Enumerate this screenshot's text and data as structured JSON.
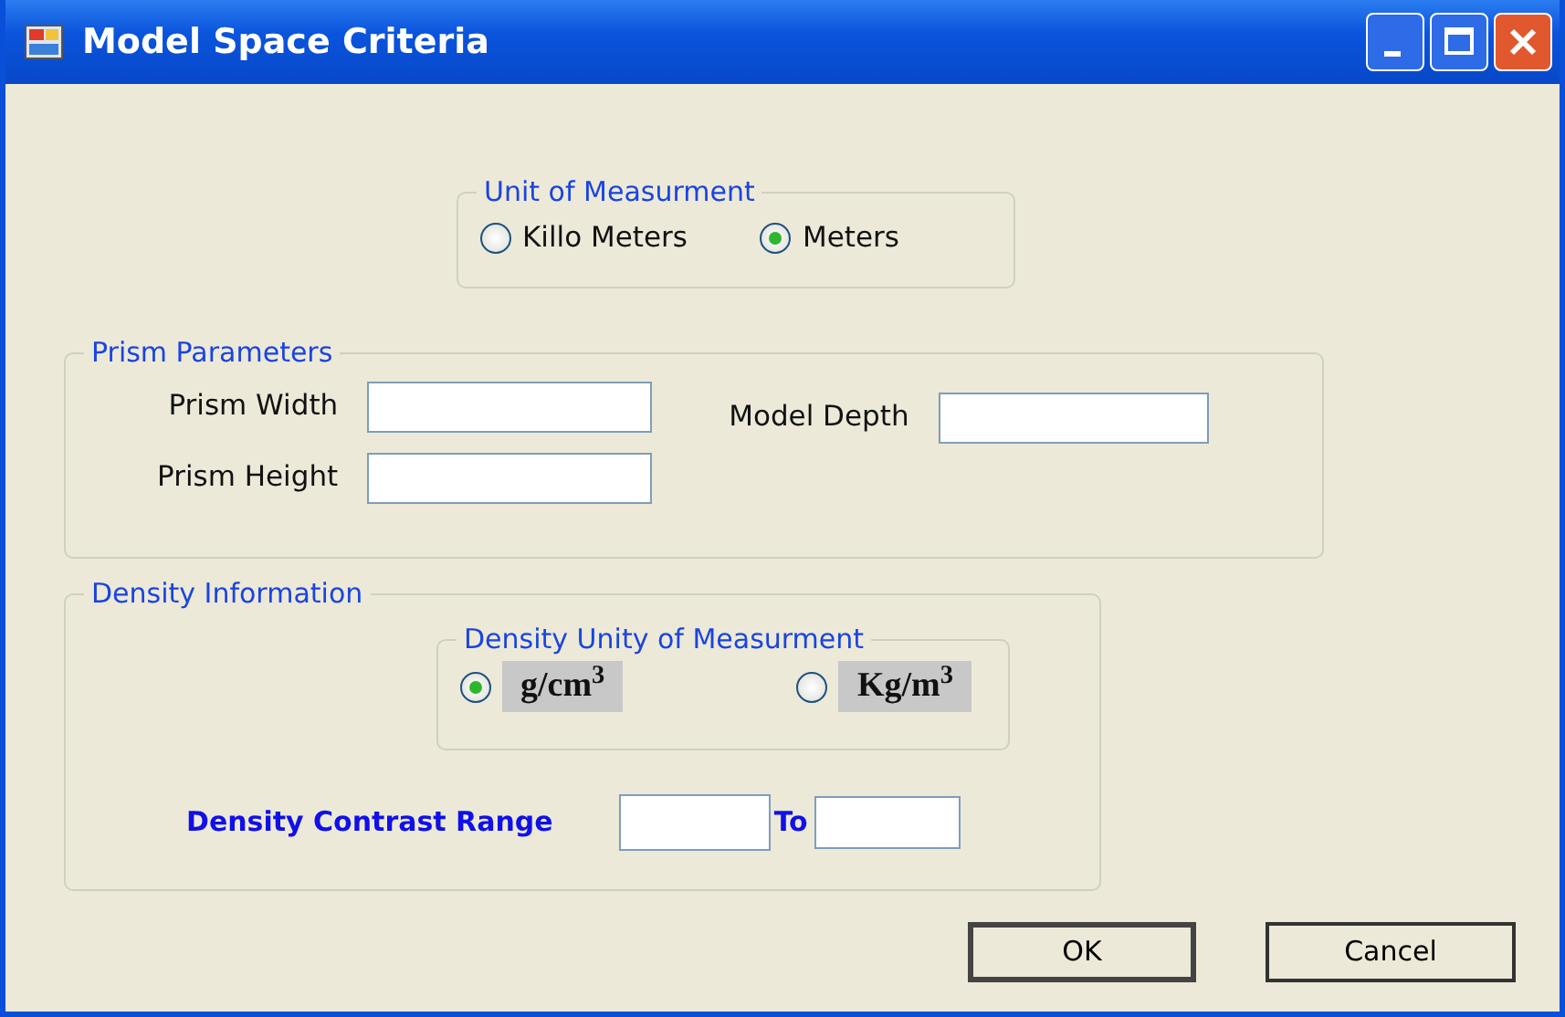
{
  "window": {
    "title": "Model Space Criteria"
  },
  "unit_of_measurement": {
    "title": "Unit of Measurment",
    "options": [
      {
        "label": "Killo Meters",
        "selected": false
      },
      {
        "label": "Meters",
        "selected": true
      }
    ]
  },
  "prism_parameters": {
    "title": "Prism Parameters",
    "fields": [
      {
        "label": "Prism Width"
      },
      {
        "label": "Prism Height"
      },
      {
        "label": "Model Depth"
      }
    ]
  },
  "density_information": {
    "title": "Density Information",
    "density_unit": {
      "title": "Density Unity of Measurment",
      "options": [
        {
          "label": "g/cm$^{3}$",
          "selected": true
        },
        {
          "label": "Kg/m$^{3}$",
          "selected": false
        }
      ]
    },
    "contrast_range": {
      "label": "Density Contrast Range",
      "separator": "To"
    }
  },
  "buttons": [
    {
      "label": "OK",
      "default": true
    },
    {
      "label": "Cancel",
      "default": false
    }
  ]
}
